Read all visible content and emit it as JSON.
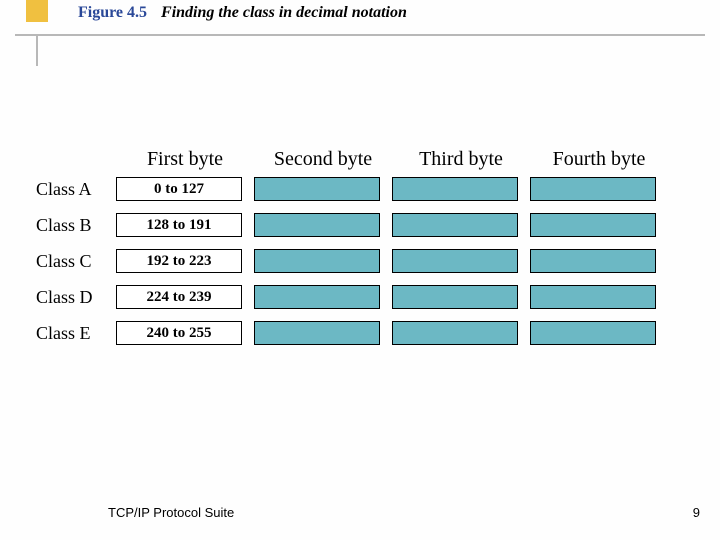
{
  "header": {
    "figure_label": "Figure 4.5",
    "figure_title": "Finding the class in decimal notation"
  },
  "columns": [
    "First byte",
    "Second byte",
    "Third byte",
    "Fourth byte"
  ],
  "rows": [
    {
      "label": "Class A",
      "range": "0 to 127"
    },
    {
      "label": "Class B",
      "range": "128 to 191"
    },
    {
      "label": "Class C",
      "range": "192 to 223"
    },
    {
      "label": "Class D",
      "range": "224 to 239"
    },
    {
      "label": "Class E",
      "range": "240 to 255"
    }
  ],
  "footer": {
    "source": "TCP/IP Protocol Suite",
    "page": "9"
  },
  "colors": {
    "accent_blue": "#2a4898",
    "accent_yellow": "#f0c040",
    "teal": "#6cb8c4"
  }
}
